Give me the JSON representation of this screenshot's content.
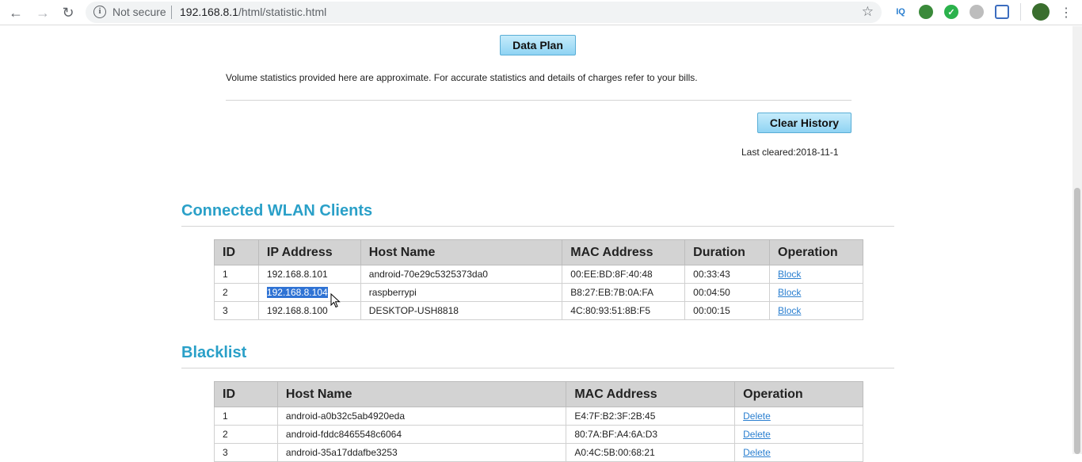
{
  "browser": {
    "security_label": "Not secure",
    "url_host": "192.168.8.1",
    "url_path": "/html/statistic.html",
    "extensions": [
      "IQ",
      "globe-ext",
      "check-ext",
      "ghost-ext",
      "square-ext",
      "profile-avatar"
    ]
  },
  "page": {
    "data_plan_label": "Data Plan",
    "note": "Volume statistics provided here are approximate. For accurate statistics and details of charges refer to your bills.",
    "clear_history_label": "Clear History",
    "last_cleared": "Last cleared:2018-11-1"
  },
  "wlan": {
    "title": "Connected WLAN Clients",
    "headers": [
      "ID",
      "IP Address",
      "Host Name",
      "MAC Address",
      "Duration",
      "Operation"
    ],
    "rows": [
      {
        "id": "1",
        "ip": "192.168.8.101",
        "host": "android-70e29c5325373da0",
        "mac": "00:EE:BD:8F:40:48",
        "duration": "00:33:43",
        "op": "Block"
      },
      {
        "id": "2",
        "ip": "192.168.8.104",
        "host": "raspberrypi",
        "mac": "B8:27:EB:7B:0A:FA",
        "duration": "00:04:50",
        "op": "Block"
      },
      {
        "id": "3",
        "ip": "192.168.8.100",
        "host": "DESKTOP-USH8818",
        "mac": "4C:80:93:51:8B:F5",
        "duration": "00:00:15",
        "op": "Block"
      }
    ]
  },
  "blacklist": {
    "title": "Blacklist",
    "headers": [
      "ID",
      "Host Name",
      "MAC Address",
      "Operation"
    ],
    "rows": [
      {
        "id": "1",
        "host": "android-a0b32c5ab4920eda",
        "mac": "E4:7F:B2:3F:2B:45",
        "op": "Delete"
      },
      {
        "id": "2",
        "host": "android-fddc8465548c6064",
        "mac": "80:7A:BF:A4:6A:D3",
        "op": "Delete"
      },
      {
        "id": "3",
        "host": "android-35a17ddafbe3253",
        "mac": "A0:4C:5B:00:68:21",
        "op": "Delete"
      }
    ]
  }
}
